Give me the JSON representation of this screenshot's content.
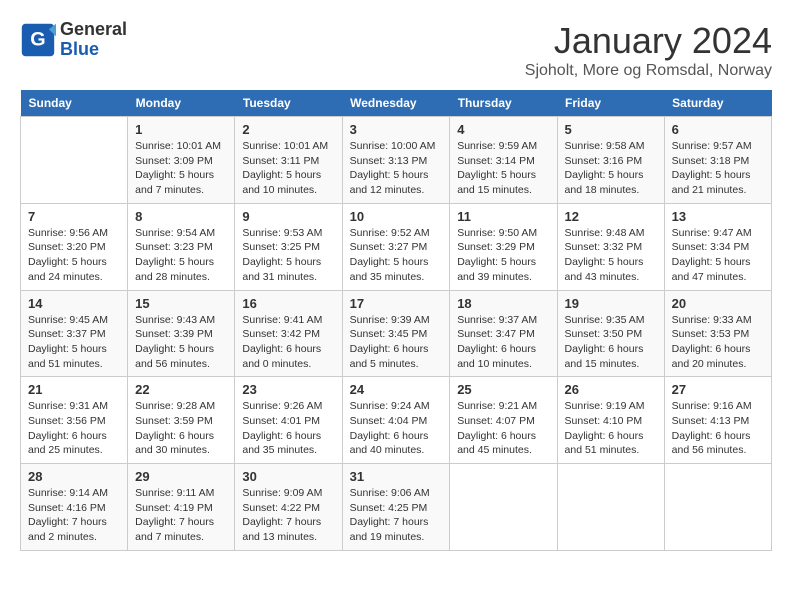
{
  "header": {
    "logo_general": "General",
    "logo_blue": "Blue",
    "month_title": "January 2024",
    "location": "Sjoholt, More og Romsdal, Norway"
  },
  "days_of_week": [
    "Sunday",
    "Monday",
    "Tuesday",
    "Wednesday",
    "Thursday",
    "Friday",
    "Saturday"
  ],
  "weeks": [
    [
      {
        "num": "",
        "info": ""
      },
      {
        "num": "1",
        "info": "Sunrise: 10:01 AM\nSunset: 3:09 PM\nDaylight: 5 hours\nand 7 minutes."
      },
      {
        "num": "2",
        "info": "Sunrise: 10:01 AM\nSunset: 3:11 PM\nDaylight: 5 hours\nand 10 minutes."
      },
      {
        "num": "3",
        "info": "Sunrise: 10:00 AM\nSunset: 3:13 PM\nDaylight: 5 hours\nand 12 minutes."
      },
      {
        "num": "4",
        "info": "Sunrise: 9:59 AM\nSunset: 3:14 PM\nDaylight: 5 hours\nand 15 minutes."
      },
      {
        "num": "5",
        "info": "Sunrise: 9:58 AM\nSunset: 3:16 PM\nDaylight: 5 hours\nand 18 minutes."
      },
      {
        "num": "6",
        "info": "Sunrise: 9:57 AM\nSunset: 3:18 PM\nDaylight: 5 hours\nand 21 minutes."
      }
    ],
    [
      {
        "num": "7",
        "info": "Sunrise: 9:56 AM\nSunset: 3:20 PM\nDaylight: 5 hours\nand 24 minutes."
      },
      {
        "num": "8",
        "info": "Sunrise: 9:54 AM\nSunset: 3:23 PM\nDaylight: 5 hours\nand 28 minutes."
      },
      {
        "num": "9",
        "info": "Sunrise: 9:53 AM\nSunset: 3:25 PM\nDaylight: 5 hours\nand 31 minutes."
      },
      {
        "num": "10",
        "info": "Sunrise: 9:52 AM\nSunset: 3:27 PM\nDaylight: 5 hours\nand 35 minutes."
      },
      {
        "num": "11",
        "info": "Sunrise: 9:50 AM\nSunset: 3:29 PM\nDaylight: 5 hours\nand 39 minutes."
      },
      {
        "num": "12",
        "info": "Sunrise: 9:48 AM\nSunset: 3:32 PM\nDaylight: 5 hours\nand 43 minutes."
      },
      {
        "num": "13",
        "info": "Sunrise: 9:47 AM\nSunset: 3:34 PM\nDaylight: 5 hours\nand 47 minutes."
      }
    ],
    [
      {
        "num": "14",
        "info": "Sunrise: 9:45 AM\nSunset: 3:37 PM\nDaylight: 5 hours\nand 51 minutes."
      },
      {
        "num": "15",
        "info": "Sunrise: 9:43 AM\nSunset: 3:39 PM\nDaylight: 5 hours\nand 56 minutes."
      },
      {
        "num": "16",
        "info": "Sunrise: 9:41 AM\nSunset: 3:42 PM\nDaylight: 6 hours\nand 0 minutes."
      },
      {
        "num": "17",
        "info": "Sunrise: 9:39 AM\nSunset: 3:45 PM\nDaylight: 6 hours\nand 5 minutes."
      },
      {
        "num": "18",
        "info": "Sunrise: 9:37 AM\nSunset: 3:47 PM\nDaylight: 6 hours\nand 10 minutes."
      },
      {
        "num": "19",
        "info": "Sunrise: 9:35 AM\nSunset: 3:50 PM\nDaylight: 6 hours\nand 15 minutes."
      },
      {
        "num": "20",
        "info": "Sunrise: 9:33 AM\nSunset: 3:53 PM\nDaylight: 6 hours\nand 20 minutes."
      }
    ],
    [
      {
        "num": "21",
        "info": "Sunrise: 9:31 AM\nSunset: 3:56 PM\nDaylight: 6 hours\nand 25 minutes."
      },
      {
        "num": "22",
        "info": "Sunrise: 9:28 AM\nSunset: 3:59 PM\nDaylight: 6 hours\nand 30 minutes."
      },
      {
        "num": "23",
        "info": "Sunrise: 9:26 AM\nSunset: 4:01 PM\nDaylight: 6 hours\nand 35 minutes."
      },
      {
        "num": "24",
        "info": "Sunrise: 9:24 AM\nSunset: 4:04 PM\nDaylight: 6 hours\nand 40 minutes."
      },
      {
        "num": "25",
        "info": "Sunrise: 9:21 AM\nSunset: 4:07 PM\nDaylight: 6 hours\nand 45 minutes."
      },
      {
        "num": "26",
        "info": "Sunrise: 9:19 AM\nSunset: 4:10 PM\nDaylight: 6 hours\nand 51 minutes."
      },
      {
        "num": "27",
        "info": "Sunrise: 9:16 AM\nSunset: 4:13 PM\nDaylight: 6 hours\nand 56 minutes."
      }
    ],
    [
      {
        "num": "28",
        "info": "Sunrise: 9:14 AM\nSunset: 4:16 PM\nDaylight: 7 hours\nand 2 minutes."
      },
      {
        "num": "29",
        "info": "Sunrise: 9:11 AM\nSunset: 4:19 PM\nDaylight: 7 hours\nand 7 minutes."
      },
      {
        "num": "30",
        "info": "Sunrise: 9:09 AM\nSunset: 4:22 PM\nDaylight: 7 hours\nand 13 minutes."
      },
      {
        "num": "31",
        "info": "Sunrise: 9:06 AM\nSunset: 4:25 PM\nDaylight: 7 hours\nand 19 minutes."
      },
      {
        "num": "",
        "info": ""
      },
      {
        "num": "",
        "info": ""
      },
      {
        "num": "",
        "info": ""
      }
    ]
  ]
}
